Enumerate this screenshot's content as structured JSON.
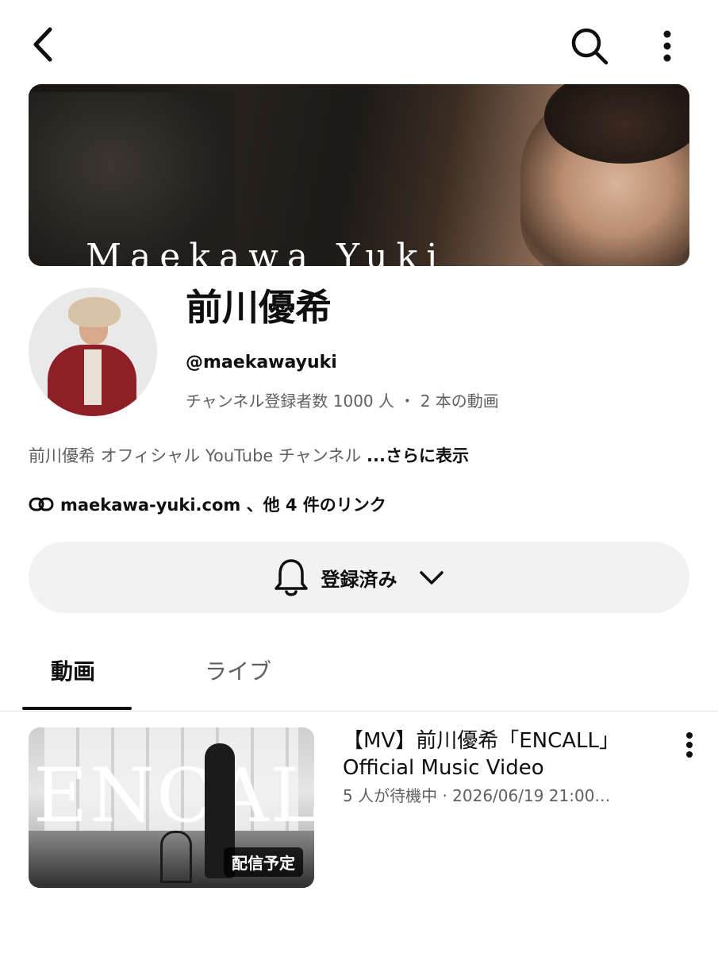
{
  "topbar": {
    "back_icon": "chevron-left-icon",
    "search_icon": "search-icon",
    "more_icon": "more-vertical-icon"
  },
  "banner": {
    "title": "Maekawa Yuki"
  },
  "channel": {
    "name": "前川優希",
    "handle": "@maekawayuki",
    "meta": "チャンネル登録者数 1000 人 ・ 2 本の動画",
    "description": "前川優希 オフィシャル YouTube チャンネル ",
    "description_more": "...さらに表示",
    "links_text": "maekawa-yuki.com 、他 4 件のリンク",
    "link_icon": "link-icon"
  },
  "subscribe": {
    "label": "登録済み",
    "bell_icon": "bell-icon",
    "chevron_icon": "chevron-down-icon"
  },
  "tabs": [
    {
      "label": "動画",
      "active": true
    },
    {
      "label": "ライブ",
      "active": false
    }
  ],
  "video": {
    "thumb_title": "ENCALL",
    "badge": "配信予定",
    "title": "【MV】前川優希「ENCALL」Official Music Video",
    "meta": "5 人が待機中 · 2026/06/19 21:00…",
    "more_icon": "more-vertical-icon"
  }
}
